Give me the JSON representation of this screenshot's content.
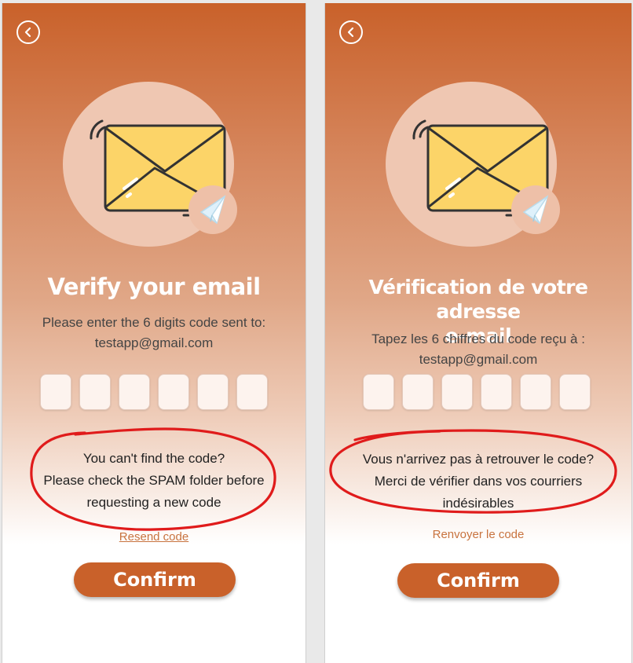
{
  "screens": [
    {
      "title": "Verify your email",
      "subtitle_line1": "Please enter the 6 digits code sent to:",
      "email": "testapp@gmail.com",
      "code_digits": [
        "",
        "",
        "",
        "",
        "",
        ""
      ],
      "help_line1": "You can't find the code?",
      "help_line2": "Please check the SPAM folder before",
      "help_line3": "requesting a new code",
      "resend_label": "Resend code",
      "confirm_label": "Confirm"
    },
    {
      "title_line1": "Vérification de votre adresse",
      "title_line2": "e-mail",
      "subtitle_line1": "Tapez les 6 chiffres du code reçu à :",
      "email": "testapp@gmail.com",
      "code_digits": [
        "",
        "",
        "",
        "",
        "",
        ""
      ],
      "help_line1": "Vous n'arrivez pas à retrouver le code?",
      "help_line2": "Merci de vérifier dans vos courriers",
      "help_line3": "indésirables",
      "resend_label": "Renvoyer le code",
      "confirm_label": "Confirm"
    }
  ],
  "colors": {
    "brand": "#c9612a",
    "link": "#c8733f",
    "annotation": "#e01b1b",
    "envelope": "#fcd468"
  },
  "icons": [
    "back-arrow-icon",
    "envelope-icon",
    "paper-plane-icon"
  ]
}
